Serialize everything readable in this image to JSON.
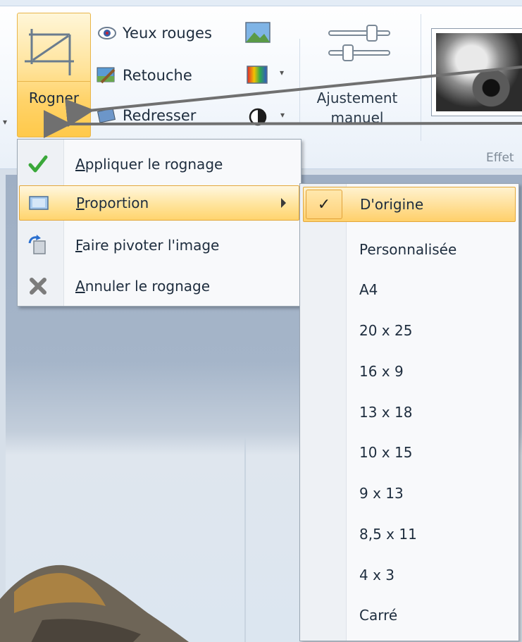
{
  "ribbon": {
    "crop_label": "Rogner",
    "small_buttons": {
      "red_eye": "Yeux rouges",
      "retouch": "Retouche",
      "straighten": "Redresser"
    },
    "adjust_label_line1": "Ajustement",
    "adjust_label_line2": "manuel",
    "effects_label": "Effet"
  },
  "crop_menu": {
    "items": [
      {
        "label": "Appliquer le rognage",
        "icon": "green-check-icon"
      },
      {
        "label": "Proportion",
        "icon": "proportion-frame-icon",
        "highlighted": true
      },
      {
        "label": "Faire pivoter l'image",
        "icon": "rotate-frame-icon"
      },
      {
        "label": "Annuler le rognage",
        "icon": "gray-x-icon"
      }
    ]
  },
  "proportion_menu": {
    "items": [
      {
        "label": "D'origine",
        "checked": true
      },
      {
        "label": "Personnalisée"
      },
      {
        "label": "A4"
      },
      {
        "label": "20 x 25"
      },
      {
        "label": "16 x 9"
      },
      {
        "label": "13 x 18"
      },
      {
        "label": "10 x 15"
      },
      {
        "label": "9 x 13"
      },
      {
        "label": "8,5 x 11"
      },
      {
        "label": "4 x 3"
      },
      {
        "label": "Carré"
      }
    ]
  },
  "colors": {
    "highlight": "#ffd46e",
    "arrow": "#707070",
    "check_green": "#3aa83a"
  }
}
